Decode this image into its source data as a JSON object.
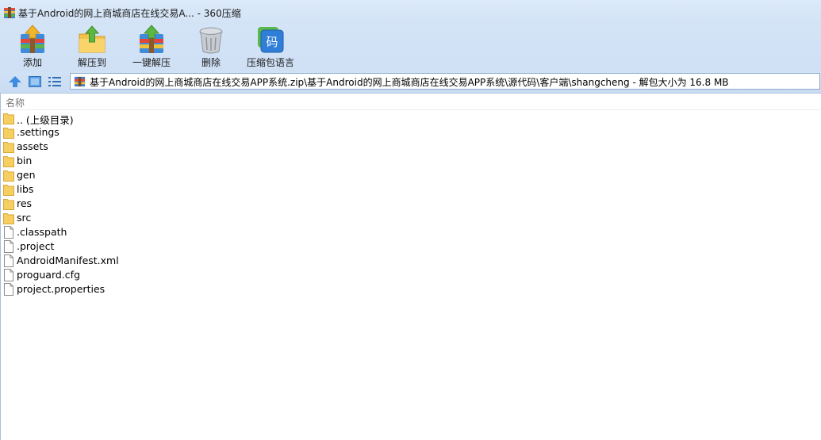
{
  "window": {
    "title": "基于Android的网上商城商店在线交易A... - 360压缩"
  },
  "toolbar": {
    "add_label": "添加",
    "extract_to_label": "解压到",
    "one_click_extract_label": "一键解压",
    "delete_label": "删除",
    "language_label": "压缩包语言",
    "language_icon_text": "码"
  },
  "address": {
    "path": "基于Android的网上商城商店在线交易APP系统.zip\\基于Android的网上商城商店在线交易APP系统\\源代码\\客户端\\shangcheng - 解包大小为 16.8 MB"
  },
  "list": {
    "column_name": "名称",
    "items": [
      {
        "name": ".. (上级目录)",
        "type": "folder"
      },
      {
        "name": ".settings",
        "type": "folder"
      },
      {
        "name": "assets",
        "type": "folder"
      },
      {
        "name": "bin",
        "type": "folder"
      },
      {
        "name": "gen",
        "type": "folder"
      },
      {
        "name": "libs",
        "type": "folder"
      },
      {
        "name": "res",
        "type": "folder"
      },
      {
        "name": "src",
        "type": "folder"
      },
      {
        "name": ".classpath",
        "type": "file"
      },
      {
        "name": ".project",
        "type": "file"
      },
      {
        "name": "AndroidManifest.xml",
        "type": "file"
      },
      {
        "name": "proguard.cfg",
        "type": "file"
      },
      {
        "name": "project.properties",
        "type": "file"
      }
    ]
  },
  "colors": {
    "folder": "#f6cf62",
    "accent": "#2f7ed8"
  }
}
